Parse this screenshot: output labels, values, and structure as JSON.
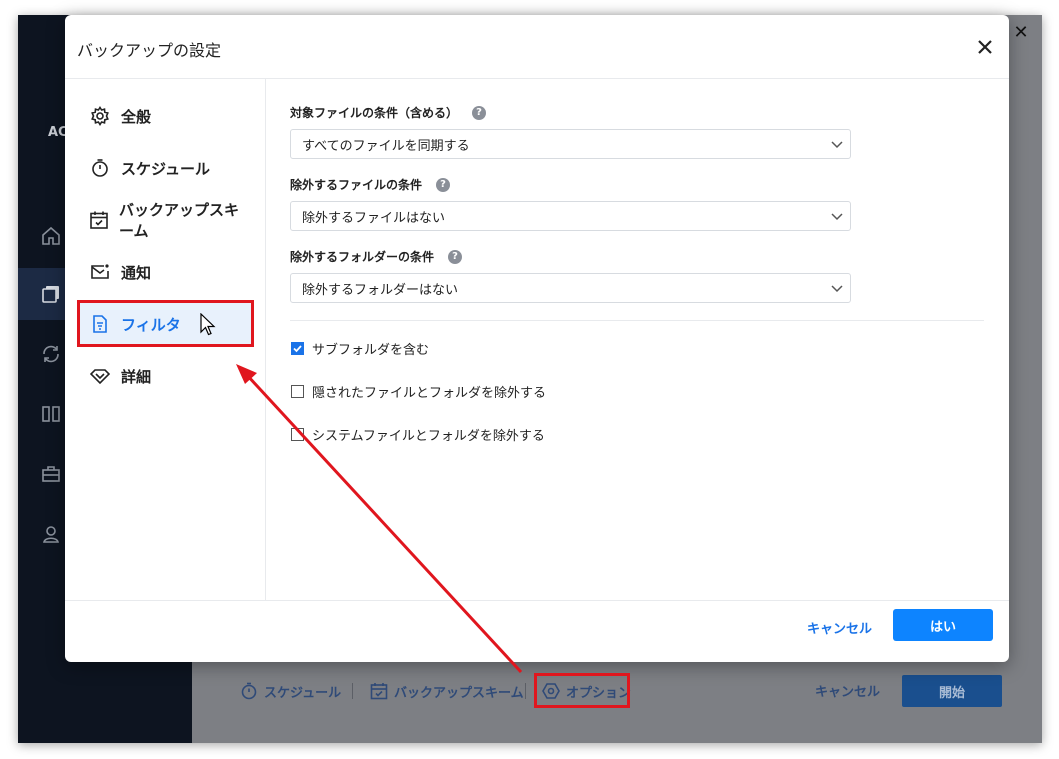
{
  "app": {
    "logo_text": "AC",
    "sidebar_icons": [
      "home-icon",
      "copy-icon",
      "sync-icon",
      "columns-icon",
      "toolbox-icon",
      "user-icon"
    ],
    "bottom": {
      "schedule_label": "スケジュール",
      "scheme_label": "バックアップスキーム",
      "options_label": "オプション",
      "cancel_label": "キャンセル",
      "start_label": "開始"
    }
  },
  "dialog": {
    "title": "バックアップの設定",
    "nav": [
      {
        "label": "全般",
        "icon": "gear-icon"
      },
      {
        "label": "スケジュール",
        "icon": "timer-icon"
      },
      {
        "label": "バックアップスキーム",
        "icon": "calendar-check-icon"
      },
      {
        "label": "通知",
        "icon": "mail-icon"
      },
      {
        "label": "フィルタ",
        "icon": "filter-doc-icon",
        "active": true
      },
      {
        "label": "詳細",
        "icon": "diamond-icon"
      }
    ],
    "filters": {
      "include_label": "対象ファイルの条件（含める）",
      "include_value": "すべてのファイルを同期する",
      "exclude_files_label": "除外するファイルの条件",
      "exclude_files_value": "除外するファイルはない",
      "exclude_folders_label": "除外するフォルダーの条件",
      "exclude_folders_value": "除外するフォルダーはない",
      "help_glyph": "?"
    },
    "checkboxes": [
      {
        "label": "サブフォルダを含む",
        "checked": true
      },
      {
        "label": "隠されたファイルとフォルダを除外する",
        "checked": false
      },
      {
        "label": "システムファイルとフォルダを除外する",
        "checked": false
      }
    ],
    "footer": {
      "cancel_label": "キャンセル",
      "ok_label": "はい"
    }
  },
  "colors": {
    "accent": "#1a73e8",
    "primary_button": "#0d84ff",
    "annotation_red": "#e0161e"
  }
}
